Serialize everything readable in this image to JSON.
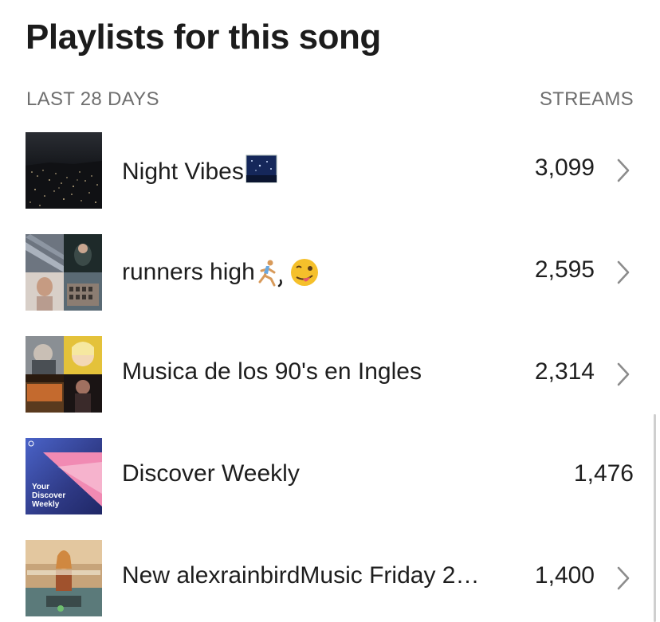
{
  "header": {
    "title": "Playlists for this song",
    "period_label": "LAST 28 DAYS",
    "streams_label": "STREAMS"
  },
  "playlists": [
    {
      "name": "Night Vibes",
      "emoji_icon": "night-sky-emoji-icon",
      "streams": "3,099",
      "has_chevron": true
    },
    {
      "name": "runners high",
      "emoji_icon": "runner-wink-emoji-icon",
      "streams": "2,595",
      "has_chevron": true
    },
    {
      "name": "Musica de los 90's en Ingles",
      "streams": "2,314",
      "has_chevron": true
    },
    {
      "name": "Discover Weekly",
      "cover_text": "Your Discover Weekly",
      "streams": "1,476",
      "has_chevron": false
    },
    {
      "name": "New alexrainbirdMusic Friday 2…",
      "streams": "1,400",
      "has_chevron": true
    }
  ],
  "colors": {
    "text": "#1e1e1e",
    "muted": "#6f6f6f",
    "chevron": "#8c8c8c"
  }
}
